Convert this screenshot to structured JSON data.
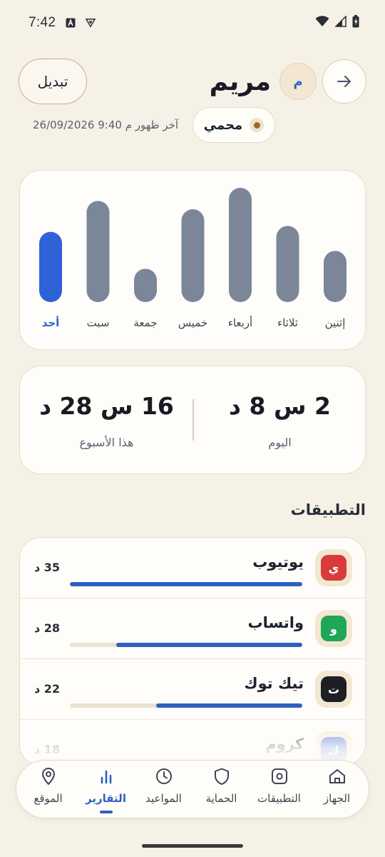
{
  "status_bar": {
    "time": "7:42"
  },
  "header": {
    "switch_label": "تبديل",
    "child_name": "مريم",
    "avatar_letter": "م",
    "last_seen": "آخر ظهور م 9:40 26/09/2026",
    "protection_status": "محمي"
  },
  "chart_data": {
    "type": "bar",
    "categories": [
      "إثنين",
      "ثلاثاء",
      "أربعاء",
      "خميس",
      "جمعة",
      "سبت",
      "أحد"
    ],
    "values": [
      4.3,
      6.4,
      9.6,
      7.8,
      2.8,
      8.5,
      5.9
    ],
    "highlighted_category": "أحد",
    "colors": {
      "default": "#7b8699",
      "highlight": "#2f62d6"
    }
  },
  "totals": {
    "today_value": "2 س 8 د",
    "today_label": "اليوم",
    "week_value": "16 س 28 د",
    "week_label": "هذا الأسبوع"
  },
  "apps_section": {
    "title": "التطبيقات",
    "items": [
      {
        "name": "يوتيوب",
        "letter": "ي",
        "minutes": "35 د",
        "share": 1.0,
        "color": "#d93a3a"
      },
      {
        "name": "واتساب",
        "letter": "و",
        "minutes": "28 د",
        "share": 0.8,
        "color": "#1fa657"
      },
      {
        "name": "تيك توك",
        "letter": "ت",
        "minutes": "22 د",
        "share": 0.63,
        "color": "#1e1f24"
      },
      {
        "name": "كروم",
        "letter": "ك",
        "minutes": "18 د",
        "share": 0.51,
        "color": "#2f62d6"
      }
    ]
  },
  "bottom_nav": {
    "items": [
      {
        "label": "الجهاز",
        "icon": "home-icon"
      },
      {
        "label": "التطبيقات",
        "icon": "apps-icon"
      },
      {
        "label": "الحماية",
        "icon": "shield-icon"
      },
      {
        "label": "المواعيد",
        "icon": "clock-icon"
      },
      {
        "label": "التقارير",
        "icon": "bar-chart-icon",
        "active": true
      },
      {
        "label": "الموقع",
        "icon": "location-pin-icon"
      }
    ]
  }
}
